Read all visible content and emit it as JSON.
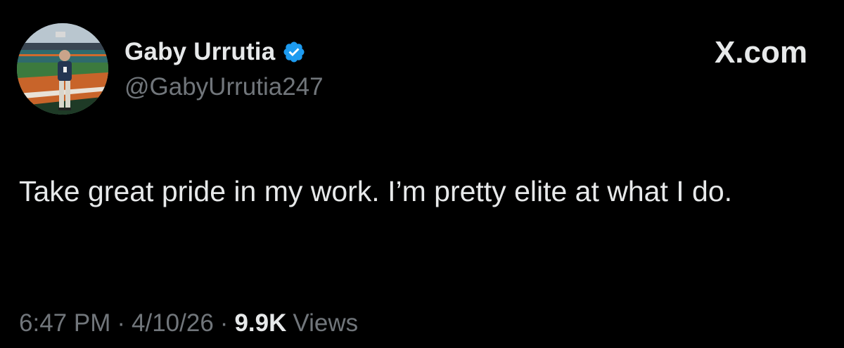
{
  "colors": {
    "background": "#000000",
    "text_primary": "#e7e9ea",
    "text_secondary": "#71767b",
    "verified_badge": "#1d9bf0"
  },
  "author": {
    "display_name": "Gaby Urrutia",
    "handle": "@GabyUrrutia247",
    "verified_icon": "verified-badge-icon",
    "avatar_icon": "profile-photo"
  },
  "brand": {
    "label": "X.com"
  },
  "tweet": {
    "text": "Take great pride in my work. I’m pretty elite at what I do."
  },
  "meta": {
    "time": "6:47 PM",
    "separator": "·",
    "date": "4/10/26",
    "views_count": "9.9K",
    "views_label": "Views"
  }
}
